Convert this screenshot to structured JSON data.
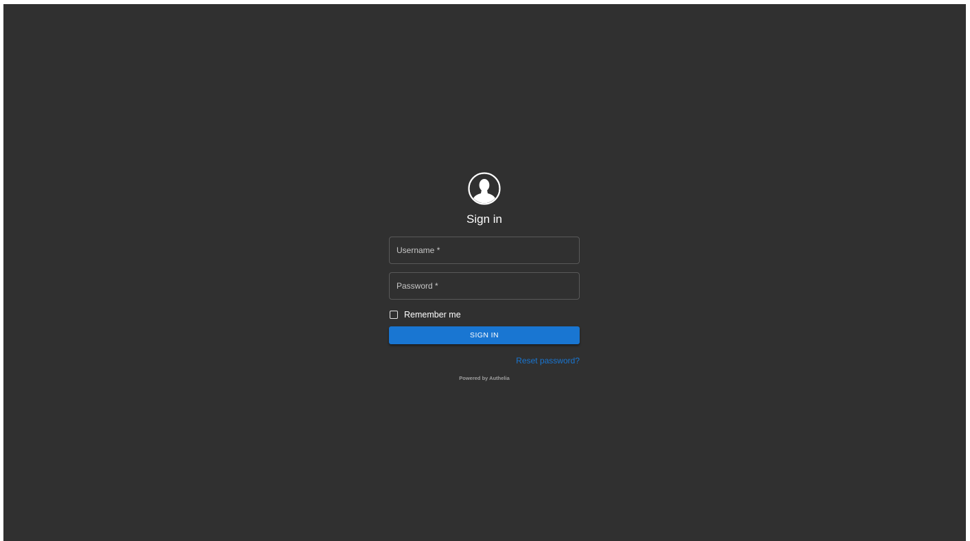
{
  "login": {
    "avatar_icon": "user-circle-icon",
    "title": "Sign in",
    "username": {
      "label": "Username *",
      "value": ""
    },
    "password": {
      "label": "Password *",
      "value": ""
    },
    "remember_me": {
      "label": "Remember me",
      "checked": false
    },
    "signin_button": "SIGN IN",
    "reset_password_link": "Reset password?",
    "powered_by": "Powered by Authelia"
  },
  "colors": {
    "background": "#303030",
    "accent": "#1976d2",
    "text": "#ffffff",
    "muted_text": "#9e9e9e",
    "field_border": "#5a5a5a"
  }
}
